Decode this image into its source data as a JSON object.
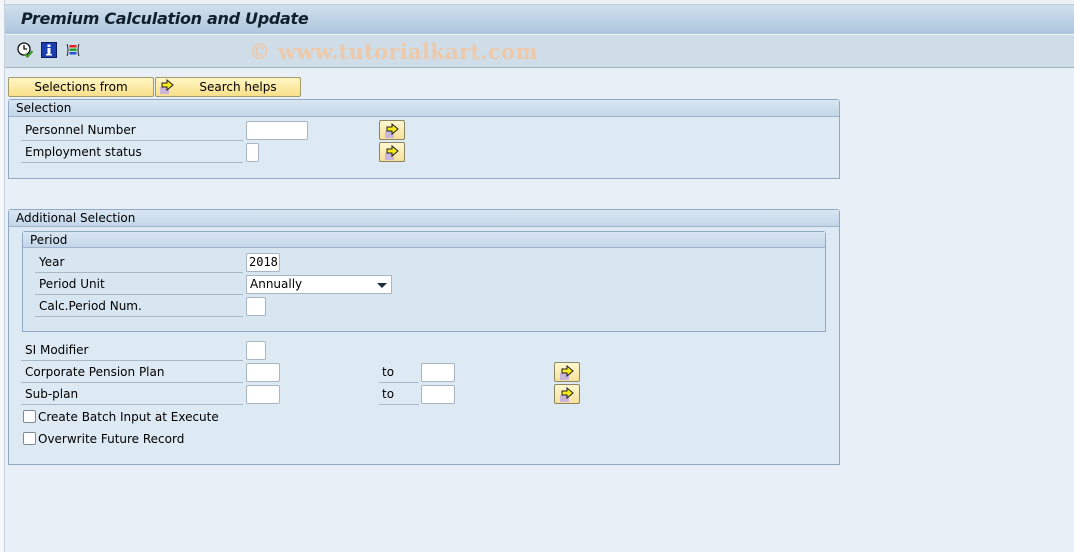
{
  "window": {
    "title": "Premium Calculation and Update",
    "watermark": "© www.tutorialkart.com"
  },
  "toolbar": {
    "icons": [
      {
        "name": "execute-clock-icon",
        "label": "Execute in Background"
      },
      {
        "name": "info-icon",
        "label": "Program Documentation"
      },
      {
        "name": "selection-options-icon",
        "label": "Selection Options"
      }
    ]
  },
  "app_buttons": {
    "selections_from": "Selections from",
    "search_helps": "Search helps"
  },
  "selection": {
    "title": "Selection",
    "personnel_number": {
      "label": "Personnel Number",
      "value": ""
    },
    "employment_status": {
      "label": "Employment status",
      "value": ""
    }
  },
  "additional": {
    "title": "Additional Selection",
    "period": {
      "title": "Period",
      "year": {
        "label": "Year",
        "value": "2018"
      },
      "period_unit": {
        "label": "Period Unit",
        "value": "Annually"
      },
      "calc_period_num": {
        "label": "Calc.Period Num.",
        "value": ""
      }
    },
    "si_modifier": {
      "label": "SI Modifier",
      "value": ""
    },
    "corporate_pension_plan": {
      "label": "Corporate Pension Plan",
      "from": "",
      "to_label": "to",
      "to": ""
    },
    "sub_plan": {
      "label": "Sub-plan",
      "from": "",
      "to_label": "to",
      "to": ""
    },
    "create_batch_input": {
      "label": "Create Batch Input at Execute",
      "checked": false
    },
    "overwrite_future": {
      "label": "Overwrite Future Record",
      "checked": false
    }
  }
}
